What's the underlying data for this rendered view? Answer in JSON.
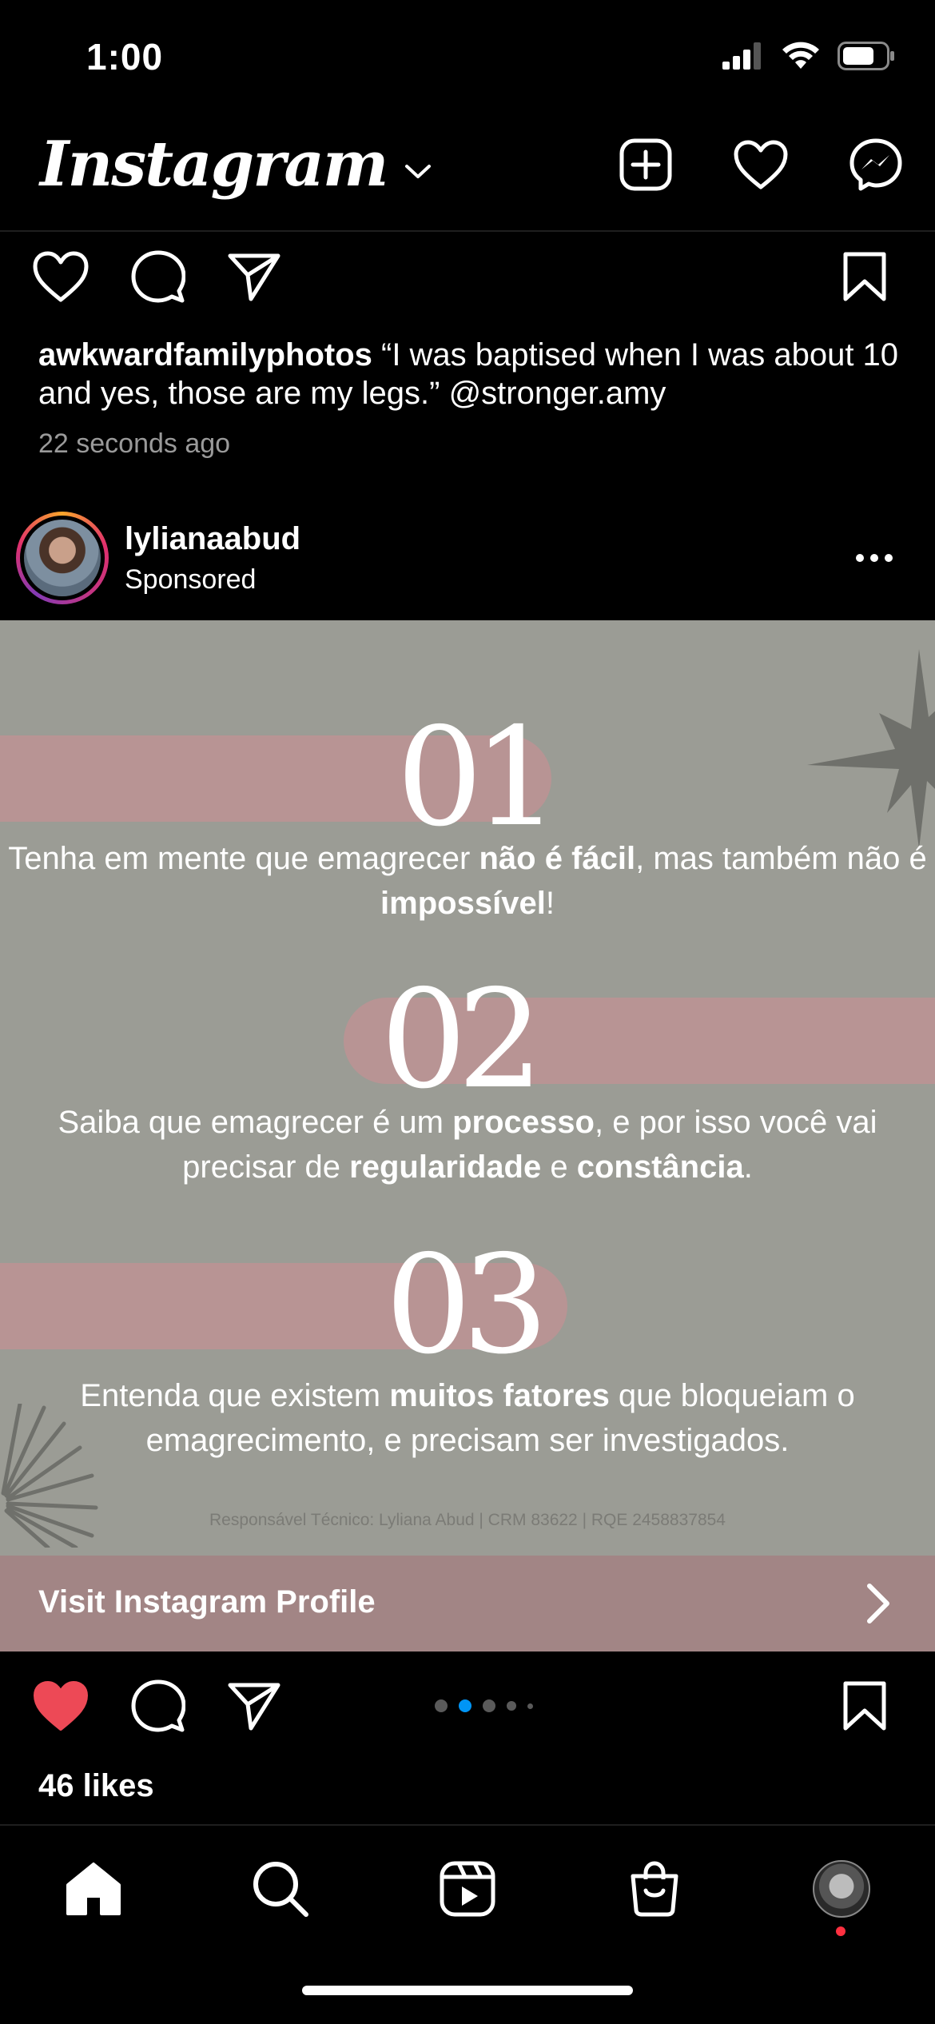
{
  "status_bar": {
    "time": "1:00"
  },
  "header": {
    "logo": "Instagram",
    "icons": [
      "plus-square-icon",
      "heart-icon",
      "messenger-icon"
    ]
  },
  "previous_post": {
    "username": "awkwardfamilyphotos",
    "caption": "“I was baptised when I was about 10 and yes, those are my legs.” @stronger.amy",
    "time_ago": "22 seconds ago"
  },
  "post": {
    "username": "lylianaabud",
    "label": "Sponsored",
    "ad": {
      "items": [
        {
          "number": "01",
          "text_parts": [
            "Tenha em mente que emagrecer ",
            "não é fácil",
            ", mas também não é ",
            "impossível",
            "!"
          ]
        },
        {
          "number": "02",
          "text_parts": [
            "Saiba que emagrecer é um ",
            "processo",
            ", e por isso você vai precisar de ",
            "regularidade",
            " e ",
            "constância",
            "."
          ]
        },
        {
          "number": "03",
          "text_parts": [
            "Entenda que existem ",
            "muitos fatores",
            " que bloqueiam o emagrecimento, e precisam ser investigados."
          ]
        }
      ],
      "footer": "Responsável Técnico: Lyliana Abud | CRM 83622 | RQE 2458837854"
    },
    "cta": "Visit Instagram Profile",
    "carousel": {
      "count": 5,
      "active_index": 1
    },
    "likes": "46 likes",
    "liked": true
  },
  "bottom_nav": [
    "home-icon",
    "search-icon",
    "reels-icon",
    "shop-icon",
    "profile-avatar"
  ],
  "colors": {
    "background": "#000000",
    "ad_background": "#9b9c95",
    "ad_stripe": "#b89494",
    "cta_background": "#a28585",
    "like_red": "#ed4956",
    "carousel_active": "#0095f6"
  }
}
